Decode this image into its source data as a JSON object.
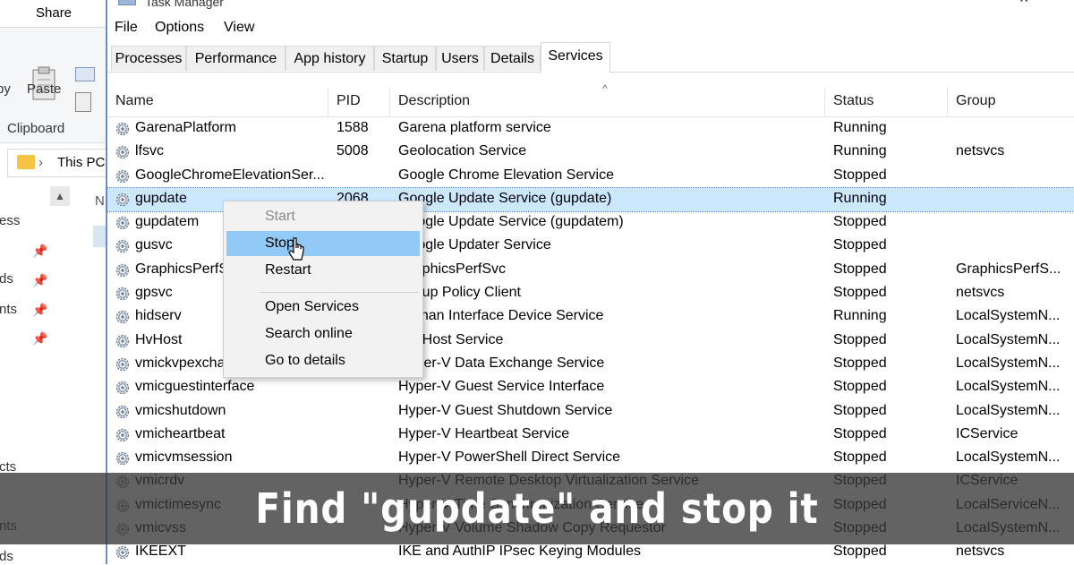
{
  "explorer": {
    "share_tab": "Share",
    "paste_label": "Paste",
    "clipboard_label": "Clipboard",
    "address_text": "This PC",
    "copy_fragment": "py",
    "nav_fragments": [
      "ess",
      "ds",
      "nts",
      "cts",
      "nts",
      "ds"
    ],
    "list_fragment": "N"
  },
  "taskmanager": {
    "title": "Task Manager",
    "menu": [
      "File",
      "Options",
      "View"
    ],
    "tabs": [
      "Processes",
      "Performance",
      "App history",
      "Startup",
      "Users",
      "Details",
      "Services"
    ],
    "active_tab": "Services",
    "columns": [
      "Name",
      "PID",
      "Description",
      "Status",
      "Group"
    ],
    "rows": [
      {
        "name": "GarenaPlatform",
        "pid": "1588",
        "desc": "Garena platform service",
        "status": "Running",
        "group": ""
      },
      {
        "name": "lfsvc",
        "pid": "5008",
        "desc": "Geolocation Service",
        "status": "Running",
        "group": "netsvcs"
      },
      {
        "name": "GoogleChromeElevationSer...",
        "pid": "",
        "desc": "Google Chrome Elevation Service",
        "status": "Stopped",
        "group": ""
      },
      {
        "name": "gupdate",
        "pid": "2068",
        "desc": "Google Update Service (gupdate)",
        "status": "Running",
        "group": ""
      },
      {
        "name": "gupdatem",
        "pid": "",
        "desc": "Google Update Service (gupdatem)",
        "status": "Stopped",
        "group": ""
      },
      {
        "name": "gusvc",
        "pid": "",
        "desc": "Google Updater Service",
        "status": "Stopped",
        "group": ""
      },
      {
        "name": "GraphicsPerfSvc",
        "pid": "",
        "desc": "GraphicsPerfSvc",
        "status": "Stopped",
        "group": "GraphicsPerfS..."
      },
      {
        "name": "gpsvc",
        "pid": "",
        "desc": "Group Policy Client",
        "status": "Stopped",
        "group": "netsvcs"
      },
      {
        "name": "hidserv",
        "pid": "",
        "desc": "Human Interface Device Service",
        "status": "Running",
        "group": "LocalSystemN..."
      },
      {
        "name": "HvHost",
        "pid": "",
        "desc": "HV Host Service",
        "status": "Stopped",
        "group": "LocalSystemN..."
      },
      {
        "name": "vmickvpexchange",
        "pid": "",
        "desc": "Hyper-V Data Exchange Service",
        "status": "Stopped",
        "group": "LocalSystemN..."
      },
      {
        "name": "vmicguestinterface",
        "pid": "",
        "desc": "Hyper-V Guest Service Interface",
        "status": "Stopped",
        "group": "LocalSystemN..."
      },
      {
        "name": "vmicshutdown",
        "pid": "",
        "desc": "Hyper-V Guest Shutdown Service",
        "status": "Stopped",
        "group": "LocalSystemN..."
      },
      {
        "name": "vmicheartbeat",
        "pid": "",
        "desc": "Hyper-V Heartbeat Service",
        "status": "Stopped",
        "group": "ICService"
      },
      {
        "name": "vmicvmsession",
        "pid": "",
        "desc": "Hyper-V PowerShell Direct Service",
        "status": "Stopped",
        "group": "LocalSystemN..."
      },
      {
        "name": "vmicrdv",
        "pid": "",
        "desc": "Hyper-V Remote Desktop Virtualization Service",
        "status": "Stopped",
        "group": "ICService"
      },
      {
        "name": "vmictimesync",
        "pid": "",
        "desc": "Hyper-V Time Synchronization Service",
        "status": "Stopped",
        "group": "LocalServiceN..."
      },
      {
        "name": "vmicvss",
        "pid": "",
        "desc": "Hyper-V Volume Shadow Copy Requestor",
        "status": "Stopped",
        "group": "LocalSystemN..."
      },
      {
        "name": "IKEEXT",
        "pid": "",
        "desc": "IKE and AuthIP IPsec Keying Modules",
        "status": "Stopped",
        "group": "netsvcs"
      }
    ],
    "selected_row": "gupdate",
    "context_menu": [
      "Start",
      "Stop",
      "Restart",
      "Open Services",
      "Search online",
      "Go to details"
    ]
  },
  "caption": "Find \"gupdate\" and stop it",
  "colors": {
    "selection": "#cce8ff",
    "menu_hover": "#91c9f7",
    "caption_bg": "#373737"
  },
  "icons": [
    "gear-icon",
    "folder-icon",
    "paste-icon",
    "cut-icon",
    "pin-icon",
    "mouse-cursor-icon",
    "close-icon"
  ]
}
